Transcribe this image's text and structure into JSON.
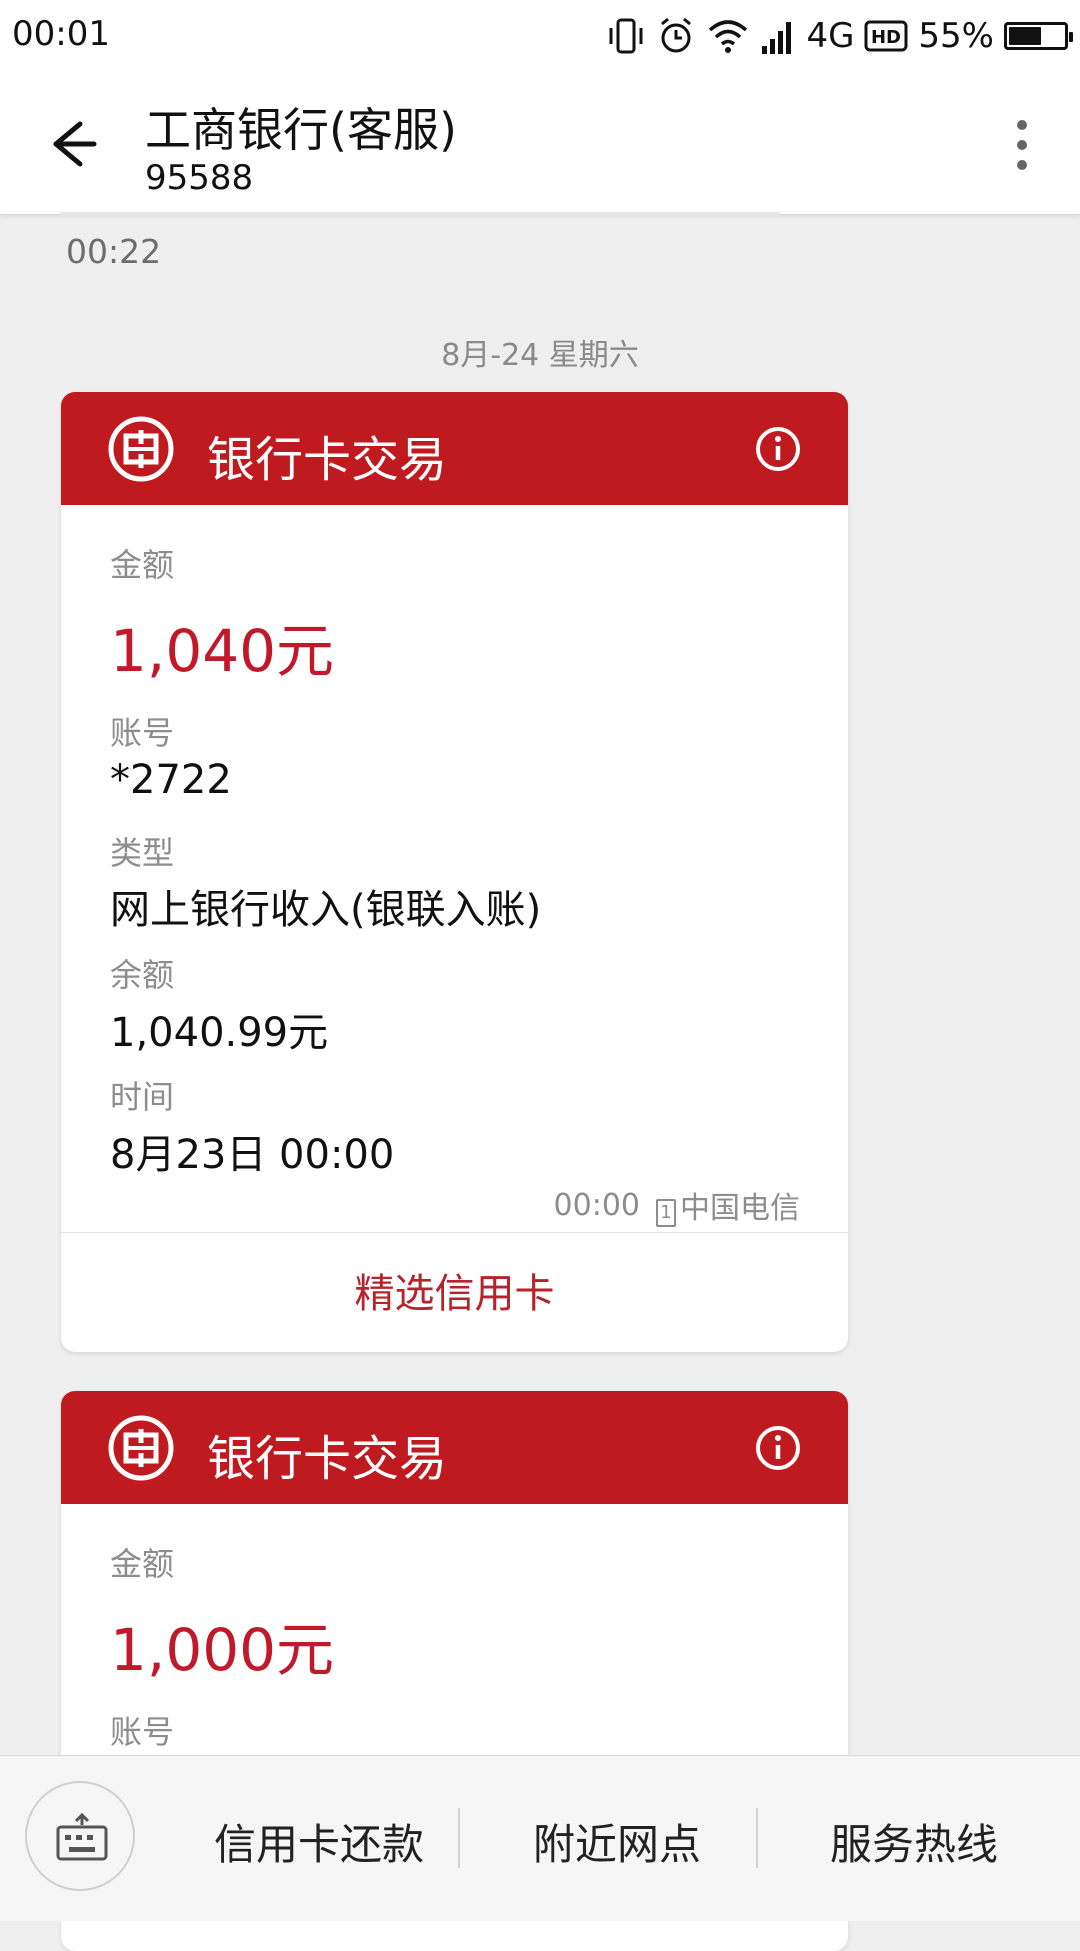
{
  "status_bar": {
    "time": "00:01",
    "network": "4G",
    "hd": "HD",
    "battery_percent_text": "55%",
    "battery_level": 0.55
  },
  "header": {
    "title": "工商银行(客服)",
    "subtitle": "95588"
  },
  "thread": {
    "previous_message_time": "00:22",
    "date_separator": "8月-24  星期六"
  },
  "cards": [
    {
      "title": "银行卡交易",
      "amount_label": "金额",
      "amount": "1,040元",
      "account_label": "账号",
      "account": "*2722",
      "type_label": "类型",
      "type": "网上银行收入(银联入账)",
      "balance_label": "余额",
      "balance": "1,040.99元",
      "time_label": "时间",
      "time": "8月23日 00:00",
      "received_time": "00:00",
      "sim_slot": "1",
      "carrier": "中国电信",
      "action_label": "精选信用卡"
    },
    {
      "title": "银行卡交易",
      "amount_label": "金额",
      "amount": "1,000元",
      "account_label": "账号"
    }
  ],
  "bottom_bar": {
    "items": [
      "信用卡还款",
      "附近网点",
      "服务热线"
    ]
  },
  "colors": {
    "brand_red": "#bf1a1f",
    "amount_red": "#c0192a",
    "background": "#efefef"
  },
  "icons": {
    "back": "arrow-left-icon",
    "more": "more-vertical-icon",
    "logo": "icbc-logo-icon",
    "info": "info-icon",
    "keyboard": "keyboard-icon"
  }
}
